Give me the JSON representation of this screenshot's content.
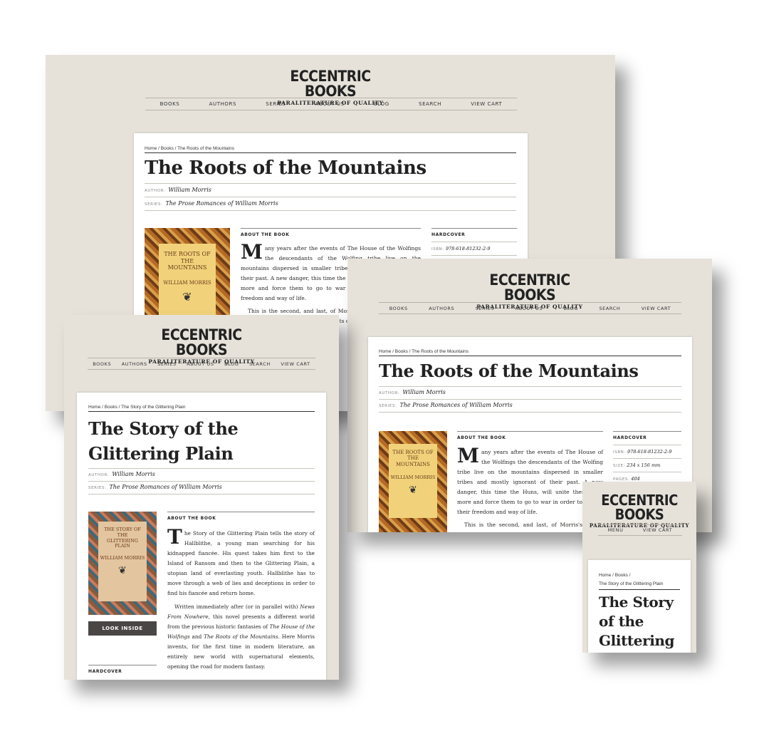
{
  "brand": {
    "name": "ECCENTRIC BOOKS",
    "tagline": "PARALITERATURE OF QUALITY"
  },
  "nav": {
    "books": "BOOKS",
    "authors": "AUTHORS",
    "series": "SERIES",
    "about": "ABOUT US",
    "blog": "BLOG",
    "search": "SEARCH",
    "cart": "VIEW CART",
    "menu": "MENU"
  },
  "labels": {
    "author": "AUTHOR:",
    "series": "SERIES:",
    "about_book": "ABOUT THE BOOK",
    "hardcover": "HARDCOVER",
    "isbn": "ISBN:",
    "size": "SIZE:",
    "pages": "PAGES:",
    "look_inside": "LOOK INSIDE"
  },
  "roots": {
    "breadcrumb": "Home / Books / The Roots of the Mountains",
    "title": "The Roots of the Mountains",
    "author": "William Morris",
    "series": "The Prose Romances of William Morris",
    "cover_title": "THE ROOTS OF THE MOUNTAINS",
    "cover_author": "WILLIAM MORRIS",
    "dropcap": "M",
    "para1": "any years after the events of The House of the Wolfings the descendants of the Wolfing tribe live on the mountains dispersed in smaller tribes and mostly ignorant of their past. A new danger, this time the Huns, will unite them once more and force them to go to war in order to defend their freedom and way of life.",
    "para2": "This is the second, and last, of Morris's novels with a strong historic background. The descendants of the Wolfings",
    "isbn": "978-618-81232-2-9",
    "size": "234 x 156 mm",
    "pages": "404"
  },
  "plain": {
    "breadcrumb": "Home / Books / The Story of the Glittering Plain",
    "breadcrumb_a": "Home / Books /",
    "breadcrumb_b": "The Story of the Glittering Plain",
    "title": "The Story of the Glittering Plain",
    "author": "William Morris",
    "series": "The Prose Romances of William Morris",
    "cover_title": "THE STORY OF THE GLITTERING PLAIN",
    "cover_author": "WILLIAM MORRIS",
    "dropcap": "T",
    "para1": "he Story of the Glittering Plain tells the story of Hallblithe, a young man searching for his kidnapped fiancée. His quest takes him first to the Island of Ransom and then to the Glittering Plain, a utopian land of everlasting youth. Hallblithe has to move through a web of lies and deceptions in order to find his fiancée and return home.",
    "para2_a": "Written immediately after (or in parallel with) ",
    "para2_i1": "News From Nowhere",
    "para2_b": ", this novel presents a different world from the previous historic fantasies of ",
    "para2_i2": "The House of the Wolfings",
    "para2_c": " and ",
    "para2_i3": "The Roots of the Mountains",
    "para2_d": ". Here Morris invents, for the first time in modern literature, an entirely new world with supernatural elements, opening the road for modern fantasy."
  },
  "colors": {
    "background": "#e6e2da",
    "page": "#ffffff",
    "ink": "#222222",
    "button": "#4a4645"
  }
}
